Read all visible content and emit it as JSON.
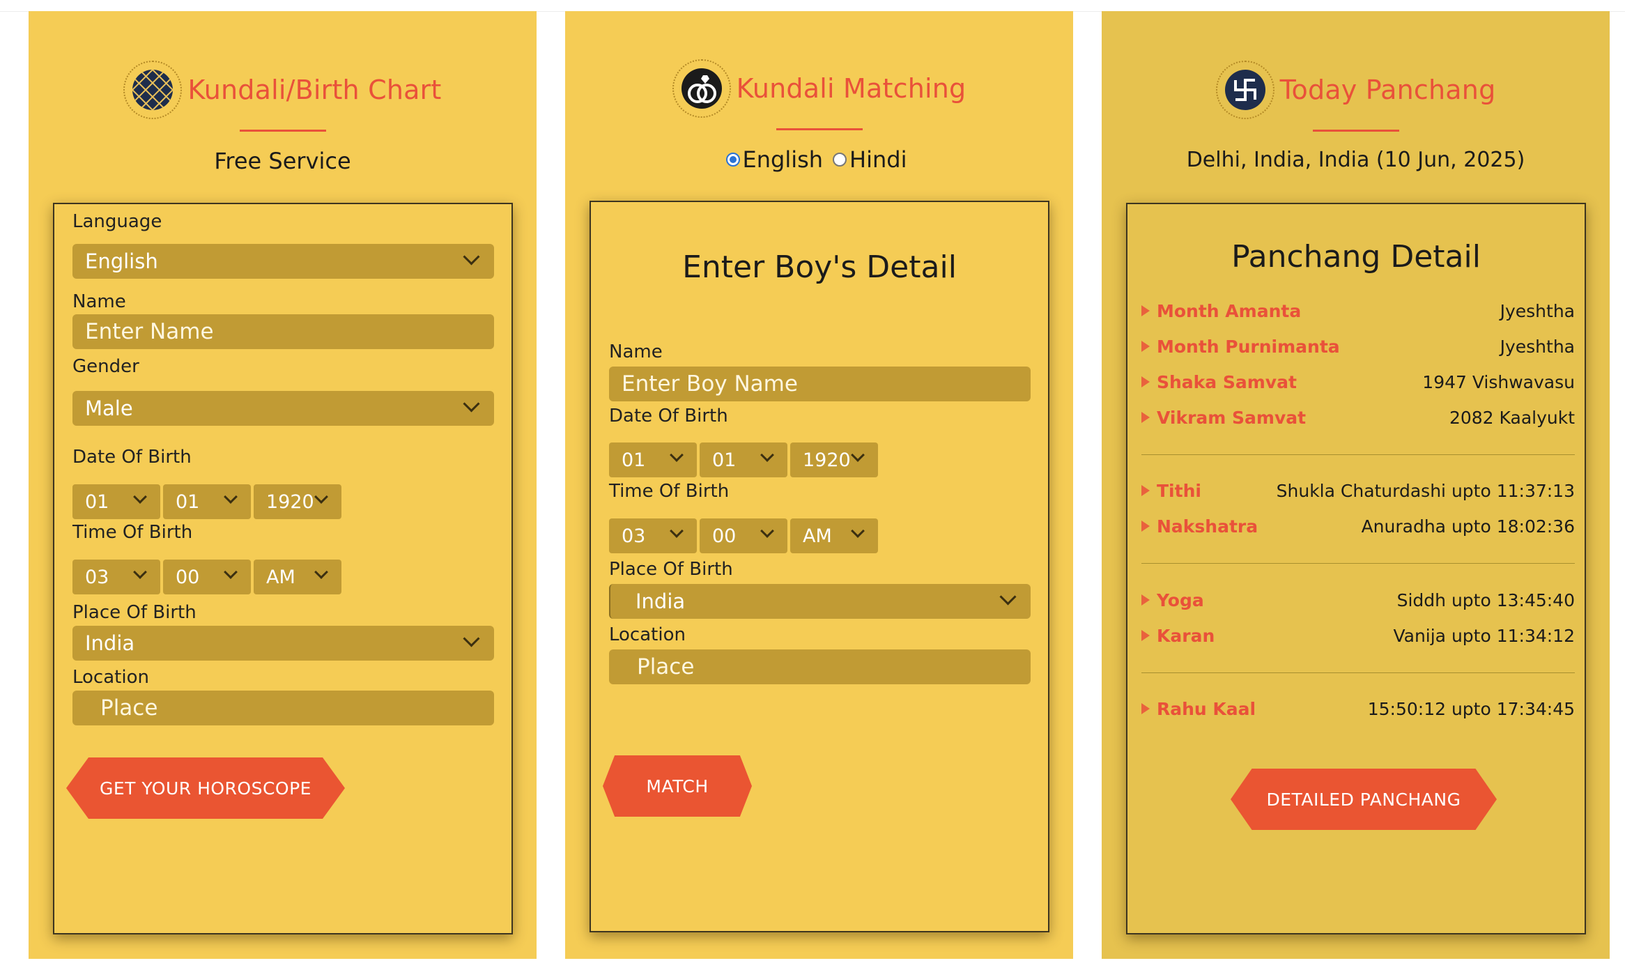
{
  "birth_chart": {
    "title": "Kundali/Birth Chart",
    "subtitle": "Free Service",
    "language_label": "Language",
    "language_value": "English",
    "name_label": "Name",
    "name_placeholder": "Enter Name",
    "gender_label": "Gender",
    "gender_value": "Male",
    "dob_label": "Date Of Birth",
    "dob_day": "01",
    "dob_month": "01",
    "dob_year": "1920",
    "tob_label": "Time Of Birth",
    "tob_hour": "03",
    "tob_minute": "00",
    "tob_ampm": "AM",
    "pob_label": "Place Of Birth",
    "pob_value": "India",
    "location_label": "Location",
    "location_placeholder": "Place",
    "button": "GET YOUR HOROSCOPE"
  },
  "matching": {
    "title": "Kundali Matching",
    "radio_english": "English",
    "radio_hindi": "Hindi",
    "card_title": "Enter Boy's Detail",
    "name_label": "Name",
    "name_placeholder": "Enter Boy Name",
    "dob_label": "Date Of Birth",
    "dob_day": "01",
    "dob_month": "01",
    "dob_year": "1920",
    "tob_label": "Time Of Birth",
    "tob_hour": "03",
    "tob_minute": "00",
    "tob_ampm": "AM",
    "pob_label": "Place Of Birth",
    "pob_value": "India",
    "location_label": "Location",
    "location_placeholder": "Place",
    "button": "MATCH"
  },
  "panchang": {
    "title": "Today Panchang",
    "subtitle": "Delhi, India, India (10 Jun, 2025)",
    "card_title": "Panchang Detail",
    "rows": [
      {
        "key": "Month Amanta",
        "value": "Jyeshtha"
      },
      {
        "key": "Month Purnimanta",
        "value": "Jyeshtha"
      },
      {
        "key": "Shaka Samvat",
        "value": "1947 Vishwavasu"
      },
      {
        "key": "Vikram Samvat",
        "value": "2082 Kaalyukt"
      },
      {
        "key": "Tithi",
        "value": "Shukla Chaturdashi upto 11:37:13"
      },
      {
        "key": "Nakshatra",
        "value": "Anuradha upto 18:02:36"
      },
      {
        "key": "Yoga",
        "value": "Siddh upto 13:45:40"
      },
      {
        "key": "Karan",
        "value": "Vanija upto 11:34:12"
      },
      {
        "key": "Rahu Kaal",
        "value": "15:50:12 upto 17:34:45"
      }
    ],
    "button": "DETAILED PANCHANG"
  },
  "colors": {
    "panel": "#f5cc55",
    "field": "#c19b34",
    "accent": "#e9513a",
    "button": "#ea5532"
  },
  "icons": {
    "birth_chart": "kundali-grid-icon",
    "matching": "rings-icon",
    "panchang": "swastika-icon"
  }
}
